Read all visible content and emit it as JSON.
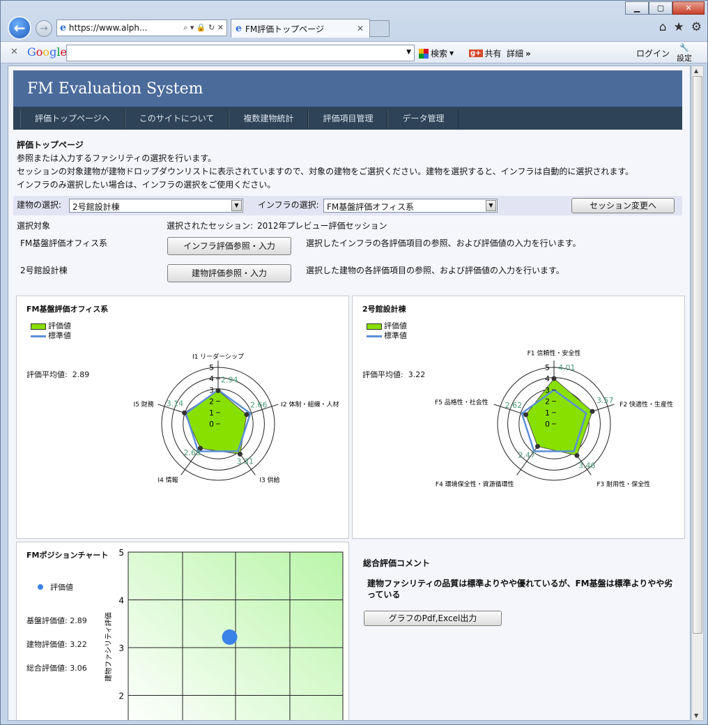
{
  "browser": {
    "address": "https://www.alph...",
    "tab_title": "FM評価トップページ",
    "google_search": "検索",
    "share": "共有",
    "more": "詳細",
    "login": "ログイン",
    "settings": "設定"
  },
  "site": {
    "title": "FM Evaluation System",
    "menu": [
      "評価トップページへ",
      "このサイトについて",
      "複数建物統計",
      "評価項目管理",
      "データ管理"
    ]
  },
  "intro": {
    "heading": "評価トップページ",
    "line1": "参照または入力するファシリティの選択を行います。",
    "line2": "セッションの対象建物が建物ドロップダウンリストに表示されていますので、対象の建物をご選択ください。建物を選択すると、インフラは自動的に選択されます。",
    "line3": "インフラのみ選択したい場合は、インフラの選択をご使用ください。"
  },
  "selection": {
    "building_label": "建物の選択:",
    "building_value": "2号館設計棟",
    "infra_label": "インフラの選択:",
    "infra_value": "FM基盤評価オフィス系",
    "session_button": "セッション変更へ",
    "target_label": "選択対象",
    "session_label": "選択されたセッション:",
    "session_value": "2012年プレビュー評価セッション",
    "infra_name": "FM基盤評価オフィス系",
    "infra_button": "インフラ評価参照・入力",
    "infra_desc": "選択したインフラの各評価項目の参照、および評価値の入力を行います。",
    "building_name": "2号館設計棟",
    "building_button": "建物評価参照・入力",
    "building_desc": "選択した建物の各評価項目の参照、および評価値の入力を行います。"
  },
  "legend": {
    "value": "評価値",
    "standard": "標準値"
  },
  "colors": {
    "fill": "#88e000",
    "standard": "#5b8fd6",
    "banner": "#4b6b9b",
    "menu": "#2e4357"
  },
  "chart_data": [
    {
      "type": "radar",
      "title": "FM基盤評価オフィス系",
      "avg_label": "評価平均値:",
      "avg_value": "2.89",
      "axes": [
        "I1 リーダーシップ",
        "I2 体制・組織・人材",
        "I3 供給",
        "I4 情報",
        "I5 財務"
      ],
      "ticks": [
        "0",
        "1",
        "2",
        "3",
        "4",
        "5"
      ],
      "values": [
        2.94,
        2.66,
        3.31,
        2.68,
        3.14
      ],
      "labels": [
        "2.94",
        "2.66",
        "3.31",
        "2.68",
        "3.14"
      ],
      "standard": [
        3,
        3,
        3,
        3,
        3
      ],
      "rmax": 5
    },
    {
      "type": "radar",
      "title": "2号館設計棟",
      "avg_label": "評価平均値:",
      "avg_value": "3.22",
      "axes": [
        "F1 信頼性・安全性",
        "F2 快適性・生産性",
        "F3 耐用性・保全性",
        "F4 環境保全性・資源循環性",
        "F5 品格性・社会性"
      ],
      "ticks": [
        "0",
        "1",
        "2",
        "3",
        "4",
        "5"
      ],
      "values": [
        4.01,
        3.57,
        3.46,
        2.47,
        2.62
      ],
      "labels": [
        "4.01",
        "3.57",
        "3.46",
        "2.47",
        "2.62"
      ],
      "standard": [
        3,
        3,
        3,
        3,
        3
      ],
      "rmax": 5
    },
    {
      "type": "scatter",
      "title": "FMポジションチャート",
      "legend": "評価値",
      "ylabel": "建物ファシリティ評価",
      "yticks": [
        "5",
        "4",
        "3",
        "2"
      ],
      "ylim": [
        1.5,
        5
      ],
      "xlim": [
        1,
        5
      ],
      "points": [
        {
          "x": 2.89,
          "y": 3.22
        }
      ],
      "stats": [
        "基盤評価値: 2.89",
        "建物評価値: 3.22",
        "総合評価値: 3.06"
      ]
    }
  ],
  "comment": {
    "title": "総合評価コメント",
    "text": "建物ファシリティの品質は標準よりやや優れているが、FM基盤は標準よりやや劣っている",
    "export_button": "グラフのPdf,Excel出力"
  }
}
